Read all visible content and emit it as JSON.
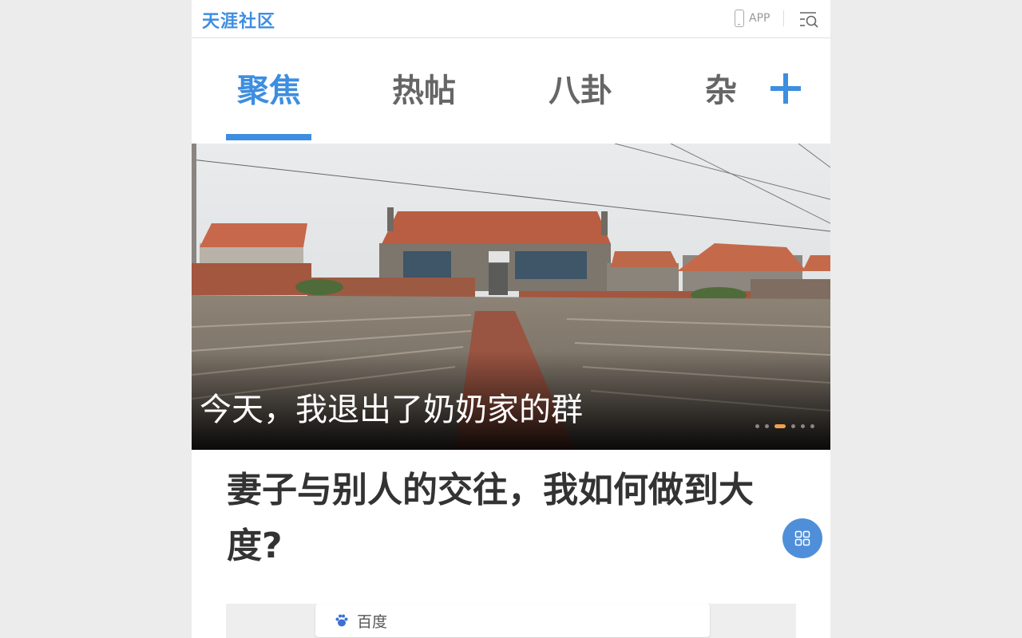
{
  "header": {
    "logo": "天涯社区",
    "app_label": "APP"
  },
  "tabs": [
    {
      "label": "聚焦",
      "active": true
    },
    {
      "label": "热帖",
      "active": false
    },
    {
      "label": "八卦",
      "active": false
    },
    {
      "label": "杂",
      "active": false
    }
  ],
  "banner": {
    "caption": "今天，我退出了奶奶家的群",
    "dots_total": 6,
    "active_dot_index": 2
  },
  "article": {
    "title": "妻子与别人的交往，我如何做到大度?"
  },
  "embed": {
    "label": "百度"
  },
  "icons": {
    "phone": "phone-icon",
    "menu_search": "menu-search-icon",
    "plus": "plus-icon",
    "grid": "grid-icon",
    "baidu": "baidu-paw-icon"
  },
  "colors": {
    "accent": "#3d8ee0",
    "active_dot": "#f0a050",
    "fab": "#4f8fd9"
  }
}
